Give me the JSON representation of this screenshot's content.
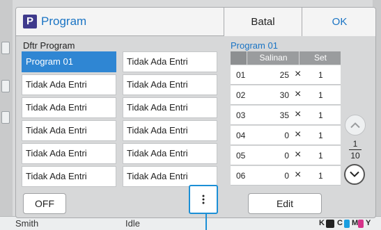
{
  "dialog": {
    "title": "Program",
    "title_icon_glyph": "P",
    "cancel_label": "Batal",
    "ok_label": "OK"
  },
  "program_list": {
    "label": "Dftr Program",
    "items": [
      "Program 01",
      "Tidak Ada Entri",
      "Tidak Ada Entri",
      "Tidak Ada Entri",
      "Tidak Ada Entri",
      "Tidak Ada Entri",
      "Tidak Ada Entri",
      "Tidak Ada Entri",
      "Tidak Ada Entri",
      "Tidak Ada Entri",
      "Tidak Ada Entri",
      "Tidak Ada Entri"
    ],
    "selected_index": 0
  },
  "detail": {
    "title": "Program 01",
    "col_copies": "Salinan",
    "col_sets": "Set",
    "rows": [
      {
        "num": "01",
        "copies": "25",
        "sets": "1"
      },
      {
        "num": "02",
        "copies": "30",
        "sets": "1"
      },
      {
        "num": "03",
        "copies": "35",
        "sets": "1"
      },
      {
        "num": "04",
        "copies": "0",
        "sets": "1"
      },
      {
        "num": "05",
        "copies": "0",
        "sets": "1"
      },
      {
        "num": "06",
        "copies": "0",
        "sets": "1"
      }
    ],
    "times_glyph": "×"
  },
  "pager": {
    "current": "1",
    "total": "10"
  },
  "bottom": {
    "off_label": "OFF",
    "edit_label": "Edit"
  },
  "status_bar": {
    "user": "Smith",
    "state": "Idle",
    "ink_labels": [
      "K",
      "C",
      "M",
      "Y"
    ]
  },
  "colors": {
    "accent": "#1a74c4",
    "selection": "#2f86d3",
    "highlight_border": "#1b8fd6"
  },
  "icons": {
    "menu": "vertical-ellipsis-icon",
    "up": "chevron-up-icon",
    "down": "chevron-down-icon",
    "title": "program-p-icon"
  }
}
